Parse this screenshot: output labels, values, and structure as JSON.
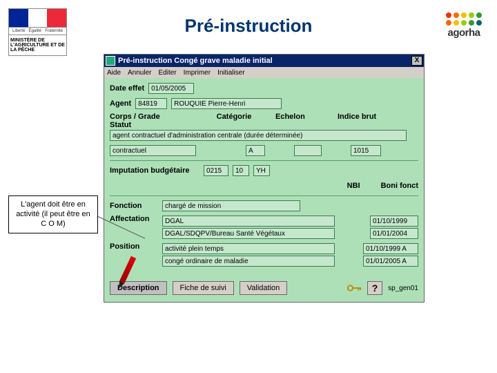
{
  "title": "Pré-instruction",
  "logo_left": {
    "tagline": "Liberté · Égalité · Fraternité",
    "ministry": "MINISTÈRE DE L'AGRICULTURE ET DE LA PÊCHE"
  },
  "logo_right": {
    "name": "agorha"
  },
  "callout": "L'agent doit être en activité (il peut être en C O M)",
  "window": {
    "title": "Pré-instruction Congé grave maladie initial",
    "menu": {
      "aide": "Aide",
      "annuler": "Annuler",
      "editer": "Editer",
      "imprimer": "Imprimer",
      "initialiser": "Initialiser"
    },
    "labels": {
      "date_effet": "Date effet",
      "agent": "Agent",
      "corps_grade": "Corps / Grade",
      "statut": "Statut",
      "categorie": "Catégorie",
      "echelon": "Echelon",
      "indice_brut": "Indice brut",
      "imputation": "Imputation budgétaire",
      "nbi": "NBI",
      "boni_fonct": "Boni fonct",
      "fonction": "Fonction",
      "affectation": "Affectation",
      "position": "Position"
    },
    "values": {
      "date_effet": "01/05/2005",
      "agent_id": "84819",
      "agent_name": "ROUQUIE Pierre-Henri",
      "corps_grade": "agent contractuel d'administration centrale (durée déterminée)",
      "statut": "contractuel",
      "categorie": "A",
      "echelon": "",
      "indice_brut": "1015",
      "imp1": "0215",
      "imp2": "10",
      "imp3": "YH",
      "fonction": "chargé de mission",
      "affect1": "DGAL",
      "affect1_date": "01/10/1999",
      "affect2": "DGAL/SDQPV/Bureau Santé Végétaux",
      "affect2_date": "01/01/2004",
      "pos1": "activité plein temps",
      "pos1_date": "01/10/1999 A",
      "pos2": "congé ordinaire de maladie",
      "pos2_date": "01/01/2005 A"
    },
    "tabs": {
      "description": "Description",
      "fiche": "Fiche de suivi",
      "validation": "Validation"
    },
    "help": "?",
    "status_id": "sp_gen01"
  }
}
